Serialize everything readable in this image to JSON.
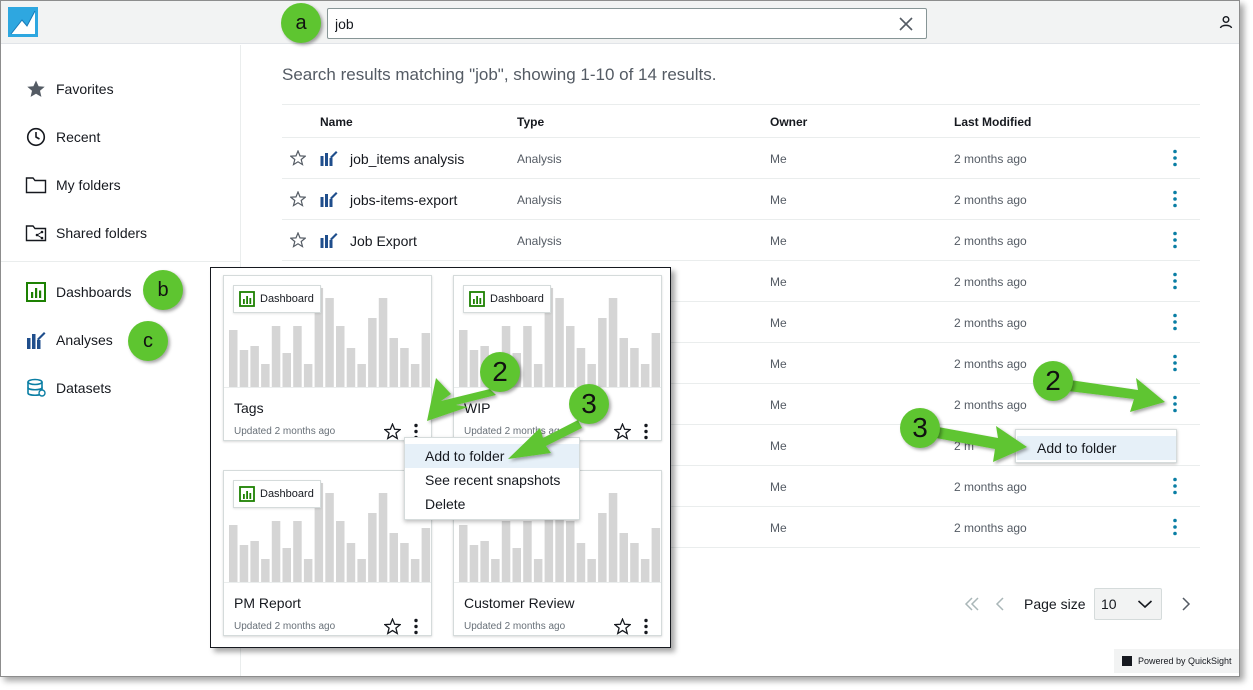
{
  "search": {
    "value": "job"
  },
  "sidebar": {
    "items": [
      {
        "label": "Favorites"
      },
      {
        "label": "Recent"
      },
      {
        "label": "My folders"
      },
      {
        "label": "Shared folders"
      },
      {
        "label": "Dashboards"
      },
      {
        "label": "Analyses"
      },
      {
        "label": "Datasets"
      }
    ]
  },
  "results": {
    "title": "Search results matching \"job\", showing 1-10 of 14 results.",
    "columns": {
      "name": "Name",
      "type": "Type",
      "owner": "Owner",
      "modified": "Last Modified"
    },
    "rows": [
      {
        "name": "job_items analysis",
        "type": "Analysis",
        "owner": "Me",
        "modified": "2 months ago"
      },
      {
        "name": "jobs-items-export",
        "type": "Analysis",
        "owner": "Me",
        "modified": "2 months ago"
      },
      {
        "name": "Job Export",
        "type": "Analysis",
        "owner": "Me",
        "modified": "2 months ago"
      },
      {
        "name": "",
        "type": "",
        "owner": "Me",
        "modified": "2 months ago"
      },
      {
        "name": "",
        "type": "",
        "owner": "Me",
        "modified": "2 months ago"
      },
      {
        "name": "",
        "type": "",
        "owner": "Me",
        "modified": "2 months ago"
      },
      {
        "name": "",
        "type": "",
        "owner": "Me",
        "modified": "2 months ago"
      },
      {
        "name": "",
        "type": "",
        "owner": "Me",
        "modified": "2 m"
      },
      {
        "name": "",
        "type": "",
        "owner": "Me",
        "modified": "2 months ago"
      },
      {
        "name": "",
        "type": "",
        "owner": "Me",
        "modified": "2 months ago"
      }
    ]
  },
  "pagination": {
    "label": "Page size",
    "value": "10"
  },
  "context_menu_right": {
    "item": "Add to folder"
  },
  "cards": [
    {
      "badge": "Dashboard",
      "title": "Tags",
      "updated": "Updated 2 months ago"
    },
    {
      "badge": "Dashboard",
      "title": "WIP",
      "updated": "Updated 2 months ago"
    },
    {
      "badge": "Dashboard",
      "title": "PM Report",
      "updated": "Updated 2 months ago"
    },
    {
      "badge": "",
      "title": "Customer Review",
      "updated": "Updated 2 months ago"
    }
  ],
  "context_menu_left": {
    "items": [
      "Add to folder",
      "See recent snapshots",
      "Delete"
    ]
  },
  "footer": {
    "powered": "Powered by QuickSight"
  },
  "annotations": {
    "a": "a",
    "b": "b",
    "c": "c",
    "two": "2",
    "three": "3"
  },
  "colors": {
    "accent": "#0073bb",
    "teal": "#0a7ea4",
    "dash_green": "#1d8102",
    "annotation": "#5ec530",
    "bar": "#d5d5d5"
  }
}
